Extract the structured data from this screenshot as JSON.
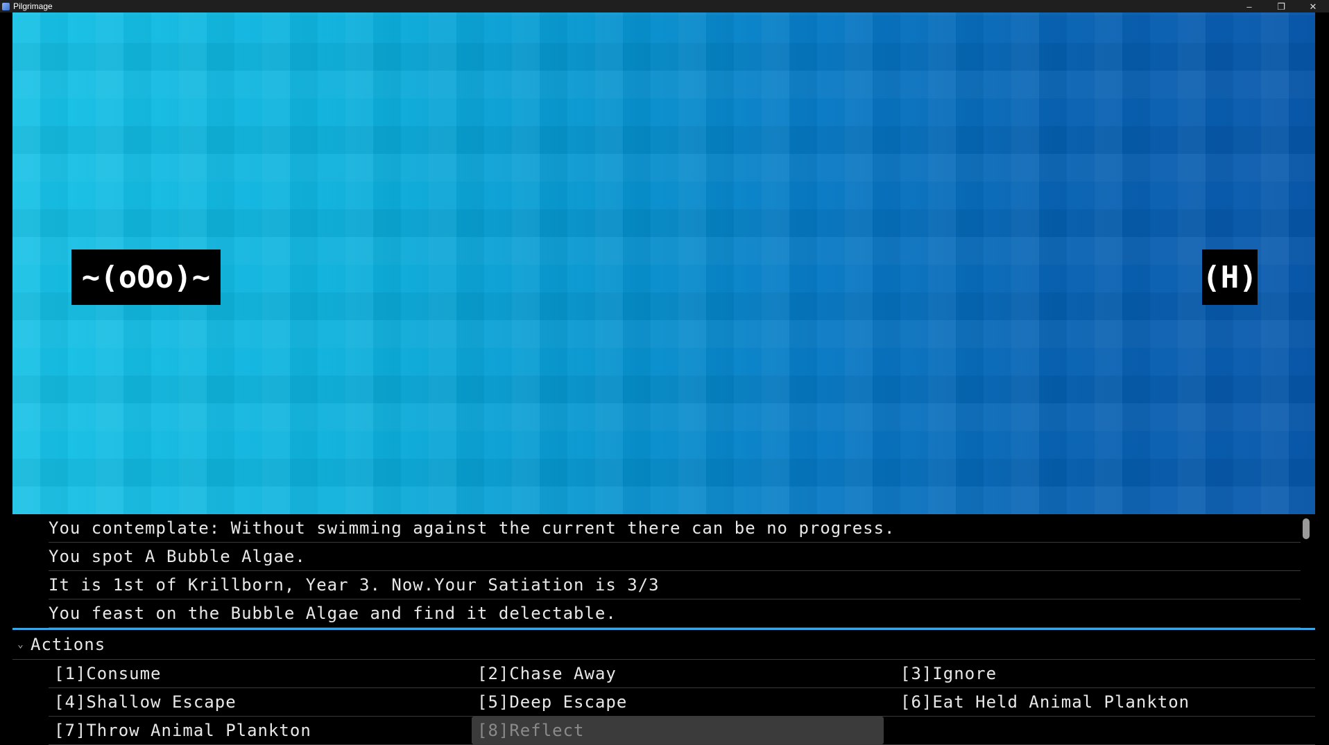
{
  "window": {
    "title": "Pilgrimage"
  },
  "scene": {
    "player_sprite": "~(oOo)~",
    "enemy_sprite": "(H)"
  },
  "log": {
    "lines": [
      "You contemplate: Without swimming against the current there can be no progress.",
      "You spot A Bubble Algae.",
      "It is 1st of Krillborn, Year 3. Now.Your Satiation is 3/3",
      "You feast on the Bubble Algae and find it delectable."
    ]
  },
  "actions": {
    "header": "Actions",
    "items": [
      {
        "label": "[1]Consume",
        "enabled": true
      },
      {
        "label": "[2]Chase Away",
        "enabled": true
      },
      {
        "label": "[3]Ignore",
        "enabled": true
      },
      {
        "label": "[4]Shallow Escape",
        "enabled": true
      },
      {
        "label": "[5]Deep Escape",
        "enabled": true
      },
      {
        "label": "[6]Eat Held Animal Plankton",
        "enabled": true
      },
      {
        "label": "[7]Throw Animal Plankton",
        "enabled": true
      },
      {
        "label": "[8]Reflect",
        "enabled": false
      }
    ]
  },
  "colors": {
    "accent_divider": "#3aa6e6",
    "water_light": "#16c1e6",
    "water_dark": "#0657ab"
  }
}
